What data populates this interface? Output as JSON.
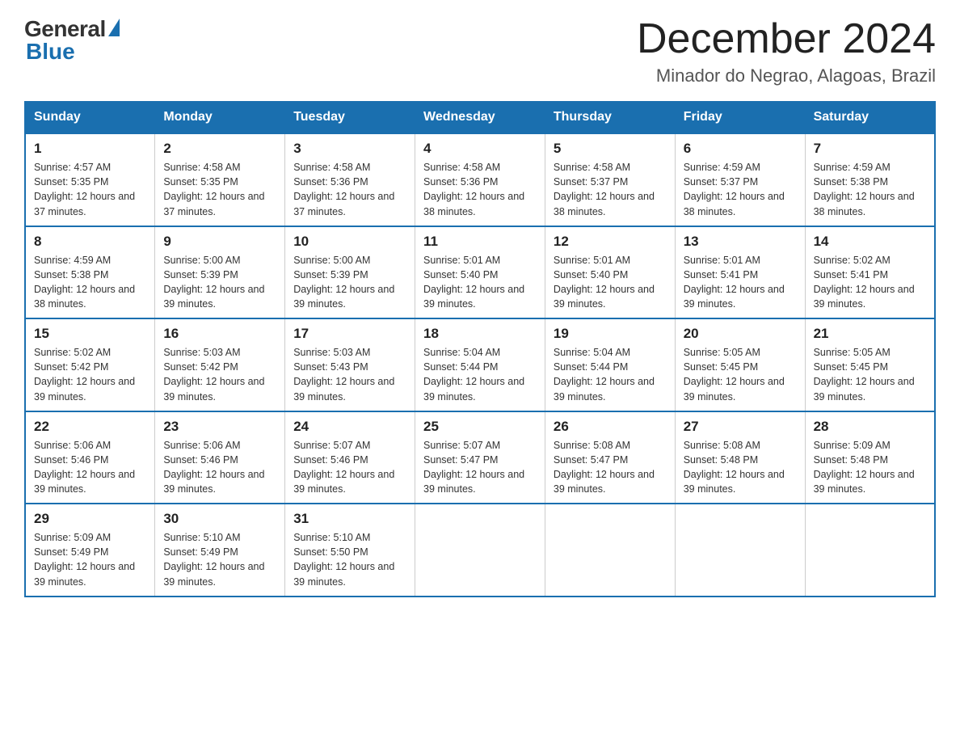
{
  "header": {
    "logo_general": "General",
    "logo_blue": "Blue",
    "month_title": "December 2024",
    "location": "Minador do Negrao, Alagoas, Brazil"
  },
  "days_of_week": [
    "Sunday",
    "Monday",
    "Tuesday",
    "Wednesday",
    "Thursday",
    "Friday",
    "Saturday"
  ],
  "weeks": [
    [
      {
        "day": 1,
        "sunrise": "4:57 AM",
        "sunset": "5:35 PM",
        "daylight": "12 hours and 37 minutes."
      },
      {
        "day": 2,
        "sunrise": "4:58 AM",
        "sunset": "5:35 PM",
        "daylight": "12 hours and 37 minutes."
      },
      {
        "day": 3,
        "sunrise": "4:58 AM",
        "sunset": "5:36 PM",
        "daylight": "12 hours and 37 minutes."
      },
      {
        "day": 4,
        "sunrise": "4:58 AM",
        "sunset": "5:36 PM",
        "daylight": "12 hours and 38 minutes."
      },
      {
        "day": 5,
        "sunrise": "4:58 AM",
        "sunset": "5:37 PM",
        "daylight": "12 hours and 38 minutes."
      },
      {
        "day": 6,
        "sunrise": "4:59 AM",
        "sunset": "5:37 PM",
        "daylight": "12 hours and 38 minutes."
      },
      {
        "day": 7,
        "sunrise": "4:59 AM",
        "sunset": "5:38 PM",
        "daylight": "12 hours and 38 minutes."
      }
    ],
    [
      {
        "day": 8,
        "sunrise": "4:59 AM",
        "sunset": "5:38 PM",
        "daylight": "12 hours and 38 minutes."
      },
      {
        "day": 9,
        "sunrise": "5:00 AM",
        "sunset": "5:39 PM",
        "daylight": "12 hours and 39 minutes."
      },
      {
        "day": 10,
        "sunrise": "5:00 AM",
        "sunset": "5:39 PM",
        "daylight": "12 hours and 39 minutes."
      },
      {
        "day": 11,
        "sunrise": "5:01 AM",
        "sunset": "5:40 PM",
        "daylight": "12 hours and 39 minutes."
      },
      {
        "day": 12,
        "sunrise": "5:01 AM",
        "sunset": "5:40 PM",
        "daylight": "12 hours and 39 minutes."
      },
      {
        "day": 13,
        "sunrise": "5:01 AM",
        "sunset": "5:41 PM",
        "daylight": "12 hours and 39 minutes."
      },
      {
        "day": 14,
        "sunrise": "5:02 AM",
        "sunset": "5:41 PM",
        "daylight": "12 hours and 39 minutes."
      }
    ],
    [
      {
        "day": 15,
        "sunrise": "5:02 AM",
        "sunset": "5:42 PM",
        "daylight": "12 hours and 39 minutes."
      },
      {
        "day": 16,
        "sunrise": "5:03 AM",
        "sunset": "5:42 PM",
        "daylight": "12 hours and 39 minutes."
      },
      {
        "day": 17,
        "sunrise": "5:03 AM",
        "sunset": "5:43 PM",
        "daylight": "12 hours and 39 minutes."
      },
      {
        "day": 18,
        "sunrise": "5:04 AM",
        "sunset": "5:44 PM",
        "daylight": "12 hours and 39 minutes."
      },
      {
        "day": 19,
        "sunrise": "5:04 AM",
        "sunset": "5:44 PM",
        "daylight": "12 hours and 39 minutes."
      },
      {
        "day": 20,
        "sunrise": "5:05 AM",
        "sunset": "5:45 PM",
        "daylight": "12 hours and 39 minutes."
      },
      {
        "day": 21,
        "sunrise": "5:05 AM",
        "sunset": "5:45 PM",
        "daylight": "12 hours and 39 minutes."
      }
    ],
    [
      {
        "day": 22,
        "sunrise": "5:06 AM",
        "sunset": "5:46 PM",
        "daylight": "12 hours and 39 minutes."
      },
      {
        "day": 23,
        "sunrise": "5:06 AM",
        "sunset": "5:46 PM",
        "daylight": "12 hours and 39 minutes."
      },
      {
        "day": 24,
        "sunrise": "5:07 AM",
        "sunset": "5:46 PM",
        "daylight": "12 hours and 39 minutes."
      },
      {
        "day": 25,
        "sunrise": "5:07 AM",
        "sunset": "5:47 PM",
        "daylight": "12 hours and 39 minutes."
      },
      {
        "day": 26,
        "sunrise": "5:08 AM",
        "sunset": "5:47 PM",
        "daylight": "12 hours and 39 minutes."
      },
      {
        "day": 27,
        "sunrise": "5:08 AM",
        "sunset": "5:48 PM",
        "daylight": "12 hours and 39 minutes."
      },
      {
        "day": 28,
        "sunrise": "5:09 AM",
        "sunset": "5:48 PM",
        "daylight": "12 hours and 39 minutes."
      }
    ],
    [
      {
        "day": 29,
        "sunrise": "5:09 AM",
        "sunset": "5:49 PM",
        "daylight": "12 hours and 39 minutes."
      },
      {
        "day": 30,
        "sunrise": "5:10 AM",
        "sunset": "5:49 PM",
        "daylight": "12 hours and 39 minutes."
      },
      {
        "day": 31,
        "sunrise": "5:10 AM",
        "sunset": "5:50 PM",
        "daylight": "12 hours and 39 minutes."
      },
      null,
      null,
      null,
      null
    ]
  ]
}
